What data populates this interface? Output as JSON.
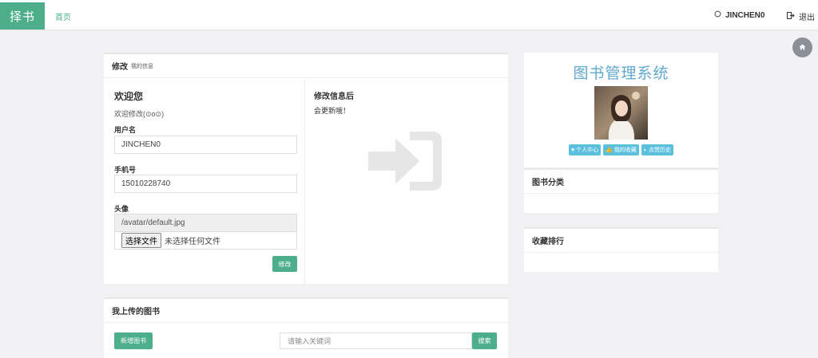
{
  "nav": {
    "brand": "择书",
    "home": "首页",
    "username": "JINCHEN0",
    "logout": "退出",
    "user_icon": "user-outline-icon",
    "logout_icon": "sign-out-icon"
  },
  "home_fab": {
    "icon": "home-icon"
  },
  "edit_panel": {
    "title": "修改",
    "subtitle": "我的信息",
    "welcome": "欢迎您",
    "welcome_sub": "欢迎修改(⊙o⊙)",
    "username_label": "用户名",
    "username_value": "JINCHEN0",
    "phone_label": "手机号",
    "phone_value": "15010228740",
    "avatar_label": "头像",
    "avatar_value": "/avatar/default.jpg",
    "file_button": "选择文件",
    "file_status": "未选择任何文件",
    "submit": "修改",
    "after_title": "修改信息后",
    "after_sub": "会更新哦！",
    "big_icon": "sign-in-icon"
  },
  "books_panel": {
    "title": "我上传的图书",
    "add_button": "新增图书",
    "search_placeholder": "请输入关键词",
    "search_button": "搜索"
  },
  "sidebar": {
    "system_title": "图书管理系统",
    "badges": [
      {
        "label": "个人中心",
        "icon": "heart-icon"
      },
      {
        "label": "我的收藏",
        "icon": "thumbs-up-icon"
      },
      {
        "label": "点赞历史",
        "icon": "contrast-icon"
      }
    ],
    "category_title": "图书分类",
    "favorites_title": "收藏排行"
  },
  "colors": {
    "accent": "#4cae8b",
    "info": "#5bc0de",
    "title_blue": "#5fa8cf"
  }
}
